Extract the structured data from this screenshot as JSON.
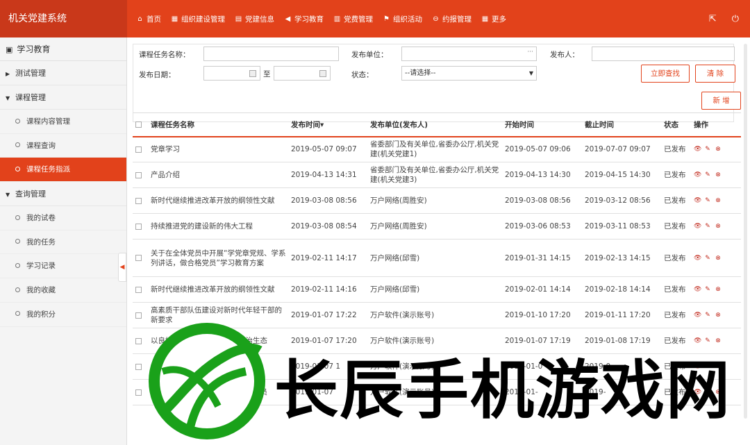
{
  "app": {
    "title": "机关党建系统"
  },
  "nav": [
    {
      "icon": "home-icon",
      "glyph": "⌂",
      "label": "首页"
    },
    {
      "icon": "org-building-icon",
      "glyph": "▦",
      "label": "组织建设管理"
    },
    {
      "icon": "info-icon",
      "glyph": "▤",
      "label": "党建信息"
    },
    {
      "icon": "megaphone-icon",
      "glyph": "◀",
      "label": "学习教育"
    },
    {
      "icon": "calendar-icon",
      "glyph": "▥",
      "label": "党费管理"
    },
    {
      "icon": "flag-icon",
      "glyph": "⚑",
      "label": "组织活动"
    },
    {
      "icon": "report-icon",
      "glyph": "⊖",
      "label": "约报管理"
    },
    {
      "icon": "grid-icon",
      "glyph": "▦",
      "label": "更多"
    }
  ],
  "top_right": [
    {
      "icon": "export-icon",
      "glyph": "⇱"
    },
    {
      "icon": "power-icon",
      "glyph": "⏻"
    }
  ],
  "sidebar": {
    "title": "学习教育",
    "groups": [
      {
        "label": "测试管理",
        "expanded": false,
        "items": []
      },
      {
        "label": "课程管理",
        "expanded": true,
        "items": [
          {
            "label": "课程内容管理",
            "active": false
          },
          {
            "label": "课程查询",
            "active": false
          },
          {
            "label": "课程任务指派",
            "active": true
          }
        ]
      },
      {
        "label": "查询管理",
        "expanded": true,
        "items": [
          {
            "label": "我的试卷",
            "active": false
          },
          {
            "label": "我的任务",
            "active": false
          },
          {
            "label": "学习记录",
            "active": false
          },
          {
            "label": "我的收藏",
            "active": false
          },
          {
            "label": "我的积分",
            "active": false
          }
        ]
      }
    ]
  },
  "filter": {
    "course_name_label": "课程任务名称：",
    "course_name_value": "",
    "publisher_unit_label": "发布单位：",
    "publisher_unit_value": "",
    "publisher_unit_picker": "···",
    "publisher_label": "发布人：",
    "publisher_value": "",
    "publish_date_label": "发布日期：",
    "date_from": "",
    "date_to_sep": "至",
    "date_to": "",
    "status_label": "状态：",
    "status_selected": "--请选择--",
    "search_button": "立即查找",
    "clear_button": "清 除",
    "add_button": "新 增"
  },
  "table": {
    "columns": [
      "课程任务名称",
      "发布时间▾",
      "发布单位(发布人)",
      "开始时间",
      "截止时间",
      "状态",
      "操作"
    ],
    "rows": [
      {
        "name": "党章学习",
        "publish_time": "2019-05-07 09:07",
        "unit": "省委部门及有关单位,省委办公厅,机关党建(机关党建1)",
        "start": "2019-05-07 09:06",
        "end": "2019-07-07 09:07",
        "status": "已发布"
      },
      {
        "name": "产品介绍",
        "publish_time": "2019-04-13 14:31",
        "unit": "省委部门及有关单位,省委办公厅,机关党建(机关党建3)",
        "start": "2019-04-13 14:30",
        "end": "2019-04-15 14:30",
        "status": "已发布"
      },
      {
        "name": "新时代继续推进改革开放的纲领性文献",
        "publish_time": "2019-03-08 08:56",
        "unit": "万户网络(周胜安)",
        "start": "2019-03-08 08:56",
        "end": "2019-03-12 08:56",
        "status": "已发布"
      },
      {
        "name": "持续推进党的建设新的伟大工程",
        "publish_time": "2019-03-08 08:54",
        "unit": "万户网络(周胜安)",
        "start": "2019-03-06 08:53",
        "end": "2019-03-11 08:53",
        "status": "已发布"
      },
      {
        "name": "关于在全体党员中开展“学党章党规、学系列讲话，做合格党员”学习教育方案",
        "publish_time": "2019-02-11 14:17",
        "unit": "万户网络(邱雪)",
        "start": "2019-01-31 14:15",
        "end": "2019-02-13 14:15",
        "status": "已发布"
      },
      {
        "name": "新时代继续推进改革开放的纲领性文献",
        "publish_time": "2019-02-11 14:16",
        "unit": "万户网络(邱雪)",
        "start": "2019-02-01 14:14",
        "end": "2019-02-18 14:14",
        "status": "已发布"
      },
      {
        "name": "高素质干部队伍建设对新时代年轻干部的新要求",
        "publish_time": "2019-01-07 17:22",
        "unit": "万户软件(演示账号)",
        "start": "2019-01-10 17:20",
        "end": "2019-01-11 17:20",
        "status": "已发布"
      },
      {
        "name": "以良好政治生态风清气正的政治生态",
        "publish_time": "2019-01-07 17:20",
        "unit": "万户软件(演示账号)",
        "start": "2019-01-07 17:19",
        "end": "2019-01-08 17:19",
        "status": "已发布"
      },
      {
        "name": "统筹“四化”部署布局学习教育",
        "publish_time": "2019-01-07 1",
        "unit": "万户软件(演示账号)",
        "start": "2019-01-0",
        "end": "2019-0",
        "status": "已发布"
      },
      {
        "name": "学习党规党纪系列讲话，做合格党员",
        "publish_time": "2019-01-07",
        "unit": "万户软件(演示账号)",
        "start": "2019-01-",
        "end": "2019-",
        "status": "已发布"
      }
    ],
    "row_action_icons": [
      "eye-icon",
      "edit-icon",
      "delete-icon"
    ]
  },
  "watermark": {
    "text": "长辰手机游戏网",
    "logo_icon": "green-ball-logo-icon"
  },
  "colors": {
    "primary": "#e2421b",
    "primary_dark": "#c9381a",
    "watermark_green": "#1aa11a"
  }
}
